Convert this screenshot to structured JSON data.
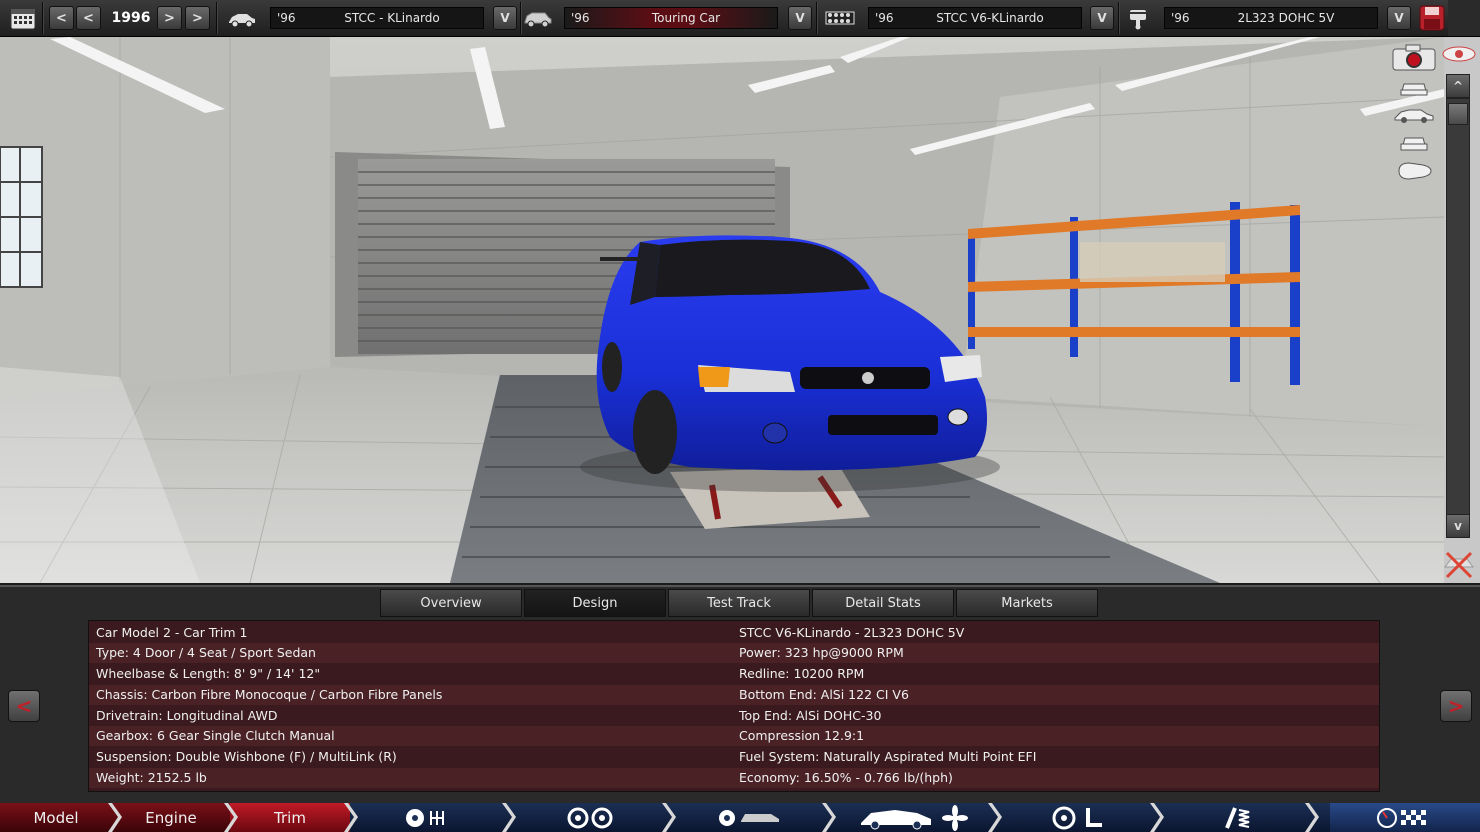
{
  "topbar": {
    "year": "1996",
    "prev_label": "<",
    "next_label": ">",
    "dropdown_label": "V",
    "model": {
      "year": "'96",
      "name": "STCC - KLinardo"
    },
    "trim": {
      "year": "'96",
      "name": "Touring Car"
    },
    "engine_family": {
      "year": "'96",
      "name": "STCC V6-KLinardo"
    },
    "engine_variant": {
      "year": "'96",
      "name": "2L323 DOHC 5V"
    }
  },
  "scrollbar": {
    "up_label": "^",
    "down_label": "v"
  },
  "tabs": [
    {
      "label": "Overview",
      "active": false
    },
    {
      "label": "Design",
      "active": true
    },
    {
      "label": "Test Track",
      "active": false
    },
    {
      "label": "Detail Stats",
      "active": false
    },
    {
      "label": "Markets",
      "active": false
    }
  ],
  "info": {
    "left": [
      "Car Model 2 - Car Trim 1",
      "Type: 4 Door / 4 Seat / Sport Sedan",
      "Wheelbase & Length: 8' 9\" / 14' 12\"",
      "Chassis: Carbon Fibre Monocoque / Carbon Fibre Panels",
      "Drivetrain: Longitudinal AWD",
      "Gearbox: 6 Gear Single Clutch Manual",
      "Suspension: Double Wishbone (F) / MultiLink (R)",
      "Weight: 2152.5 lb"
    ],
    "right": [
      "STCC V6-KLinardo - 2L323 DOHC 5V",
      "Power: 323 hp@9000 RPM",
      "Redline: 10200 RPM",
      "Bottom End: AlSi 122 CI V6",
      "Top End: AlSi DOHC-30",
      "Compression 12.9:1",
      "Fuel System: Naturally Aspirated Multi Point EFI",
      "Economy: 16.50% - 0.766 lb/(hph)"
    ]
  },
  "side_arrows": {
    "left": "<",
    "right": ">"
  },
  "bottom_nav": [
    {
      "label": "Model"
    },
    {
      "label": "Engine"
    },
    {
      "label": "Trim"
    }
  ],
  "colors": {
    "accent_red": "#c0202a",
    "car_blue": "#1a2fd6",
    "nav_blue": "#1b2f55"
  }
}
